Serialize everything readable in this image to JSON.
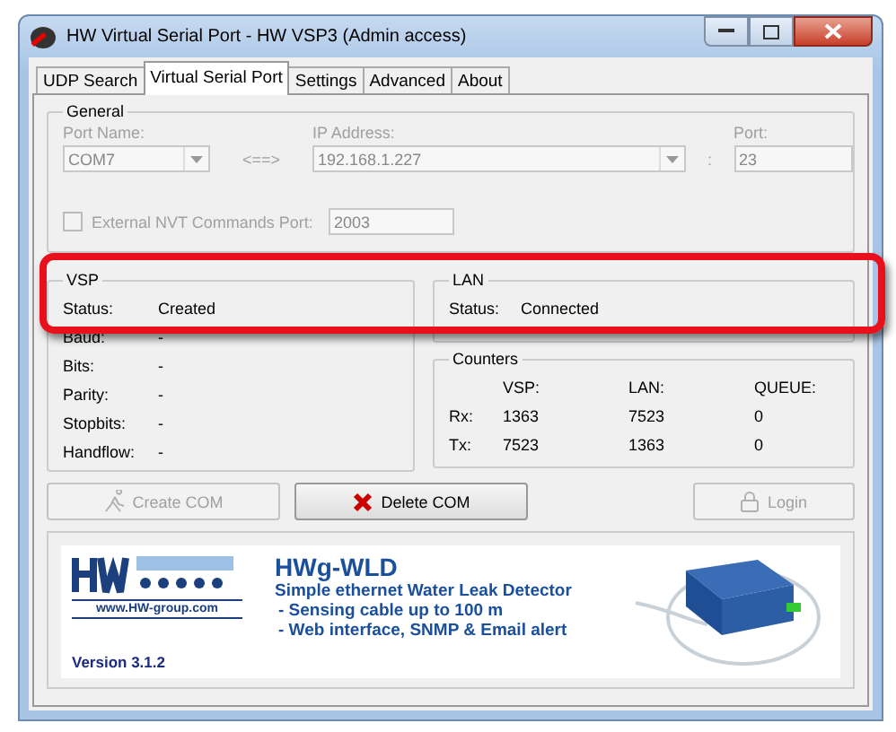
{
  "window": {
    "title": "HW Virtual Serial Port - HW VSP3 (Admin access)"
  },
  "tabs": [
    {
      "label": "UDP Search",
      "selected": false
    },
    {
      "label": "Virtual Serial Port",
      "selected": true
    },
    {
      "label": "Settings",
      "selected": false
    },
    {
      "label": "Advanced",
      "selected": false
    },
    {
      "label": "About",
      "selected": false
    }
  ],
  "general": {
    "title": "General",
    "disabled": true,
    "port_name": {
      "label": "Port Name:",
      "value": "COM7"
    },
    "arrow": "<==>",
    "ip_address": {
      "label": "IP Address:",
      "value": "192.168.1.227"
    },
    "colon": ":",
    "port": {
      "label": "Port:",
      "value": "23"
    },
    "nvt": {
      "label": "External NVT Commands Port:",
      "checked": false,
      "value": "2003"
    }
  },
  "vsp": {
    "title": "VSP",
    "rows": [
      {
        "label": "Status:",
        "value": "Created"
      },
      {
        "label": "Baud:",
        "value": "-"
      },
      {
        "label": "Bits:",
        "value": "-"
      },
      {
        "label": "Parity:",
        "value": "-"
      },
      {
        "label": "Stopbits:",
        "value": "-"
      },
      {
        "label": "Handflow:",
        "value": "-"
      }
    ]
  },
  "lan": {
    "title": "LAN",
    "status_label": "Status:",
    "status": "Connected"
  },
  "counters": {
    "title": "Counters",
    "columns": [
      "VSP:",
      "LAN:",
      "QUEUE:"
    ],
    "rows": [
      {
        "label": "Rx:",
        "values": [
          "1363",
          "7523",
          "0"
        ]
      },
      {
        "label": "Tx:",
        "values": [
          "7523",
          "1363",
          "0"
        ]
      }
    ]
  },
  "buttons": [
    {
      "kind": "create",
      "label": "Create COM",
      "disabled": true
    },
    {
      "kind": "delete",
      "label": "Delete COM",
      "disabled": false
    },
    {
      "kind": "login",
      "label": "Login",
      "disabled": true
    }
  ],
  "banner": {
    "logo_url": "www.HW-group.com",
    "version": "Version  3.1.2",
    "product": "HWg-WLD",
    "tagline": "Simple ethernet Water Leak Detector",
    "bullets": [
      "- Sensing cable up to 100 m",
      "- Web interface, SNMP & Email alert"
    ]
  }
}
